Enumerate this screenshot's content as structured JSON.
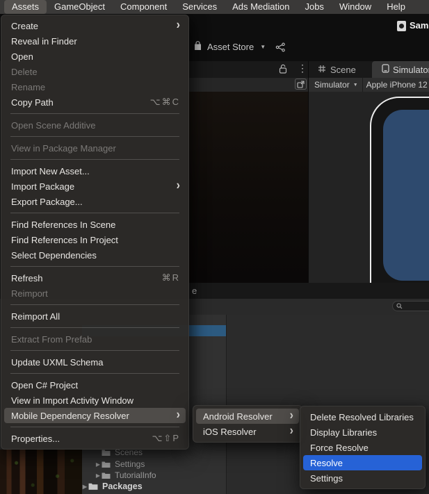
{
  "menubar": {
    "items": [
      {
        "label": "Assets",
        "selected": true
      },
      {
        "label": "GameObject"
      },
      {
        "label": "Component"
      },
      {
        "label": "Services"
      },
      {
        "label": "Ads Mediation"
      },
      {
        "label": "Jobs"
      },
      {
        "label": "Window"
      },
      {
        "label": "Help"
      }
    ]
  },
  "titlebar": {
    "partial_label": "Sam"
  },
  "asset_store": {
    "tab_label": "Asset Store"
  },
  "view_tabs": {
    "scene": "Scene",
    "simulator": "Simulator"
  },
  "simulator_toolbar": {
    "mode": "Simulator",
    "device": "Apple iPhone 12"
  },
  "bottom_tabs": {
    "partial_label": "e"
  },
  "assets_menu": {
    "items": [
      {
        "label": "Create",
        "has_submenu": true
      },
      {
        "label": "Reveal in Finder"
      },
      {
        "label": "Open"
      },
      {
        "label": "Delete",
        "disabled": true
      },
      {
        "label": "Rename",
        "disabled": true
      },
      {
        "label": "Copy Path",
        "shortcut": "⌥⌘C"
      },
      {
        "label": "Open Scene Additive",
        "disabled": true
      },
      {
        "label": "View in Package Manager",
        "disabled": true
      },
      {
        "label": "Import New Asset..."
      },
      {
        "label": "Import Package",
        "has_submenu": true
      },
      {
        "label": "Export Package..."
      },
      {
        "label": "Find References In Scene"
      },
      {
        "label": "Find References In Project"
      },
      {
        "label": "Select Dependencies"
      },
      {
        "label": "Refresh",
        "shortcut": "⌘R"
      },
      {
        "label": "Reimport",
        "disabled": true
      },
      {
        "label": "Reimport All"
      },
      {
        "label": "Extract From Prefab",
        "disabled": true
      },
      {
        "label": "Update UXML Schema"
      },
      {
        "label": "Open C# Project"
      },
      {
        "label": "View in Import Activity Window"
      },
      {
        "label": "Mobile Dependency Resolver",
        "highlighted": true,
        "has_submenu": true
      },
      {
        "label": "Properties...",
        "shortcut": "⌥⇧P"
      }
    ]
  },
  "mobile_submenu": {
    "items": [
      {
        "label": "Android Resolver",
        "highlighted": true,
        "has_submenu": true
      },
      {
        "label": "iOS Resolver",
        "has_submenu": true
      }
    ]
  },
  "android_submenu": {
    "items": [
      {
        "label": "Delete Resolved Libraries"
      },
      {
        "label": "Display Libraries"
      },
      {
        "label": "Force Resolve"
      },
      {
        "label": "Resolve",
        "selected": true
      },
      {
        "label": "Settings"
      }
    ]
  },
  "project_panel": {
    "folders": [
      {
        "label": "Scenes"
      },
      {
        "label": "Settings"
      },
      {
        "label": "TutorialInfo"
      },
      {
        "label": "Packages"
      }
    ]
  },
  "colors": {
    "menu_highlight": "#4f4c49",
    "selection_blue": "#2662d6",
    "project_selection": "#2c5a80",
    "simulator_screen": "#2e4a6e"
  }
}
